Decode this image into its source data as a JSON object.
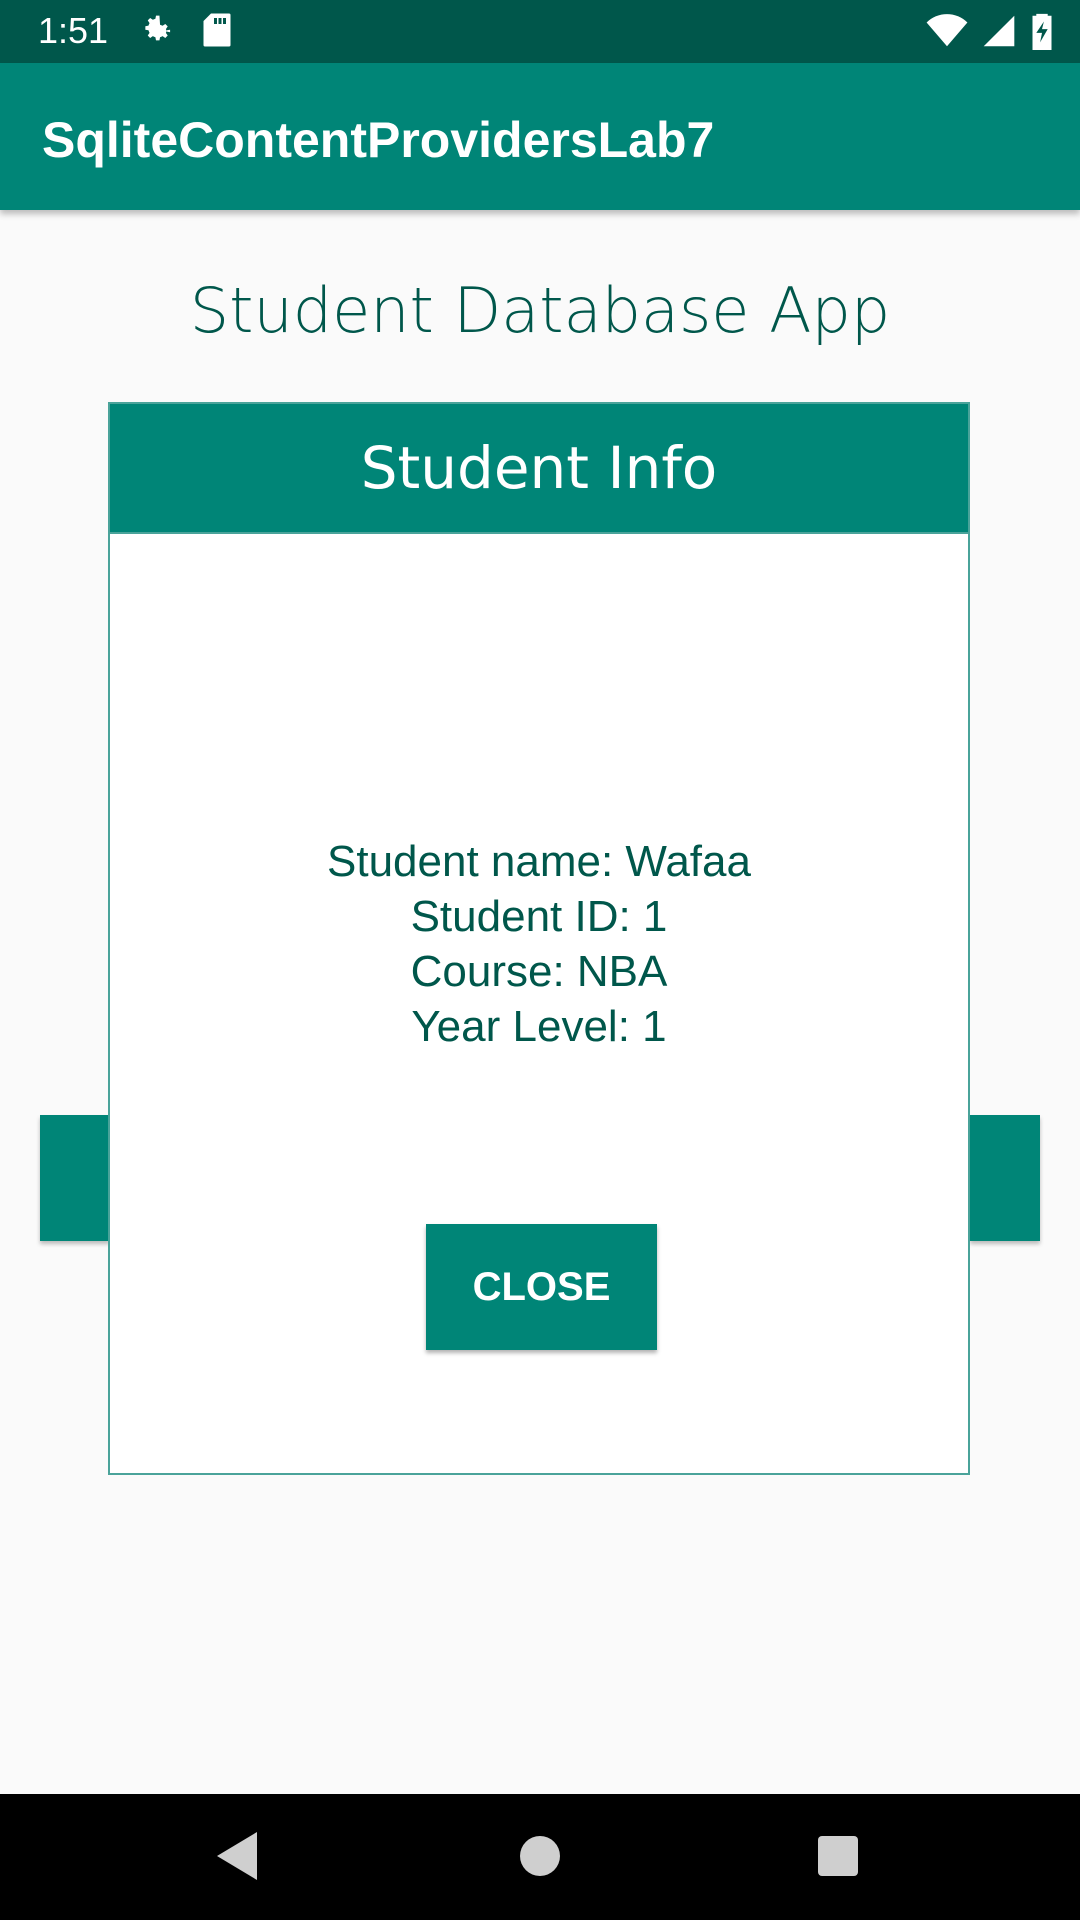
{
  "status_bar": {
    "time": "1:51",
    "left_icons": [
      "gear-icon",
      "sd-card-icon"
    ],
    "right_icons": [
      "wifi-icon",
      "cell-signal-icon",
      "battery-charging-icon"
    ]
  },
  "app_bar": {
    "title": "SqliteContentProvidersLab7"
  },
  "page": {
    "heading": "Student Database App"
  },
  "dialog": {
    "title": "Student Info",
    "lines": [
      "Student name:  Wafaa",
      "Student ID: 1",
      "Course:  NBA",
      "Year Level: 1"
    ],
    "close_label": "CLOSE"
  },
  "nav_bar": {
    "icons": [
      "back-icon",
      "home-icon",
      "recents-icon"
    ]
  },
  "colors": {
    "primary": "#008577",
    "primary_dark": "#00574b"
  }
}
